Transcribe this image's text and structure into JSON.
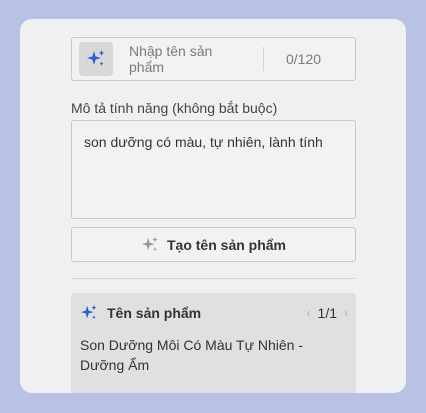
{
  "product_name": {
    "placeholder": "Nhập tên sản phẩm",
    "counter": "0/120"
  },
  "description": {
    "label": "Mô tả tính năng (không bắt buộc)",
    "value": "son dưỡng có màu, tự nhiên, lành tính"
  },
  "generate_button": {
    "label": "Tạo tên sản phẩm"
  },
  "result": {
    "title": "Tên sản phẩm",
    "page": "1/1",
    "prev_arrow": "‹",
    "next_arrow": "›",
    "text": "Son Dưỡng Môi Có Màu Tự Nhiên - Dưỡng Ẩm"
  },
  "icons": {
    "input_icon": "sparkle-icon",
    "button_icon": "sparkle-icon",
    "result_icon": "sparkle-icon"
  },
  "colors": {
    "background": "#b8c2e4",
    "panel": "#f0f0f0",
    "sparkle_blue": "#2f5fd0",
    "sparkle_grey": "#9a9a9a"
  }
}
